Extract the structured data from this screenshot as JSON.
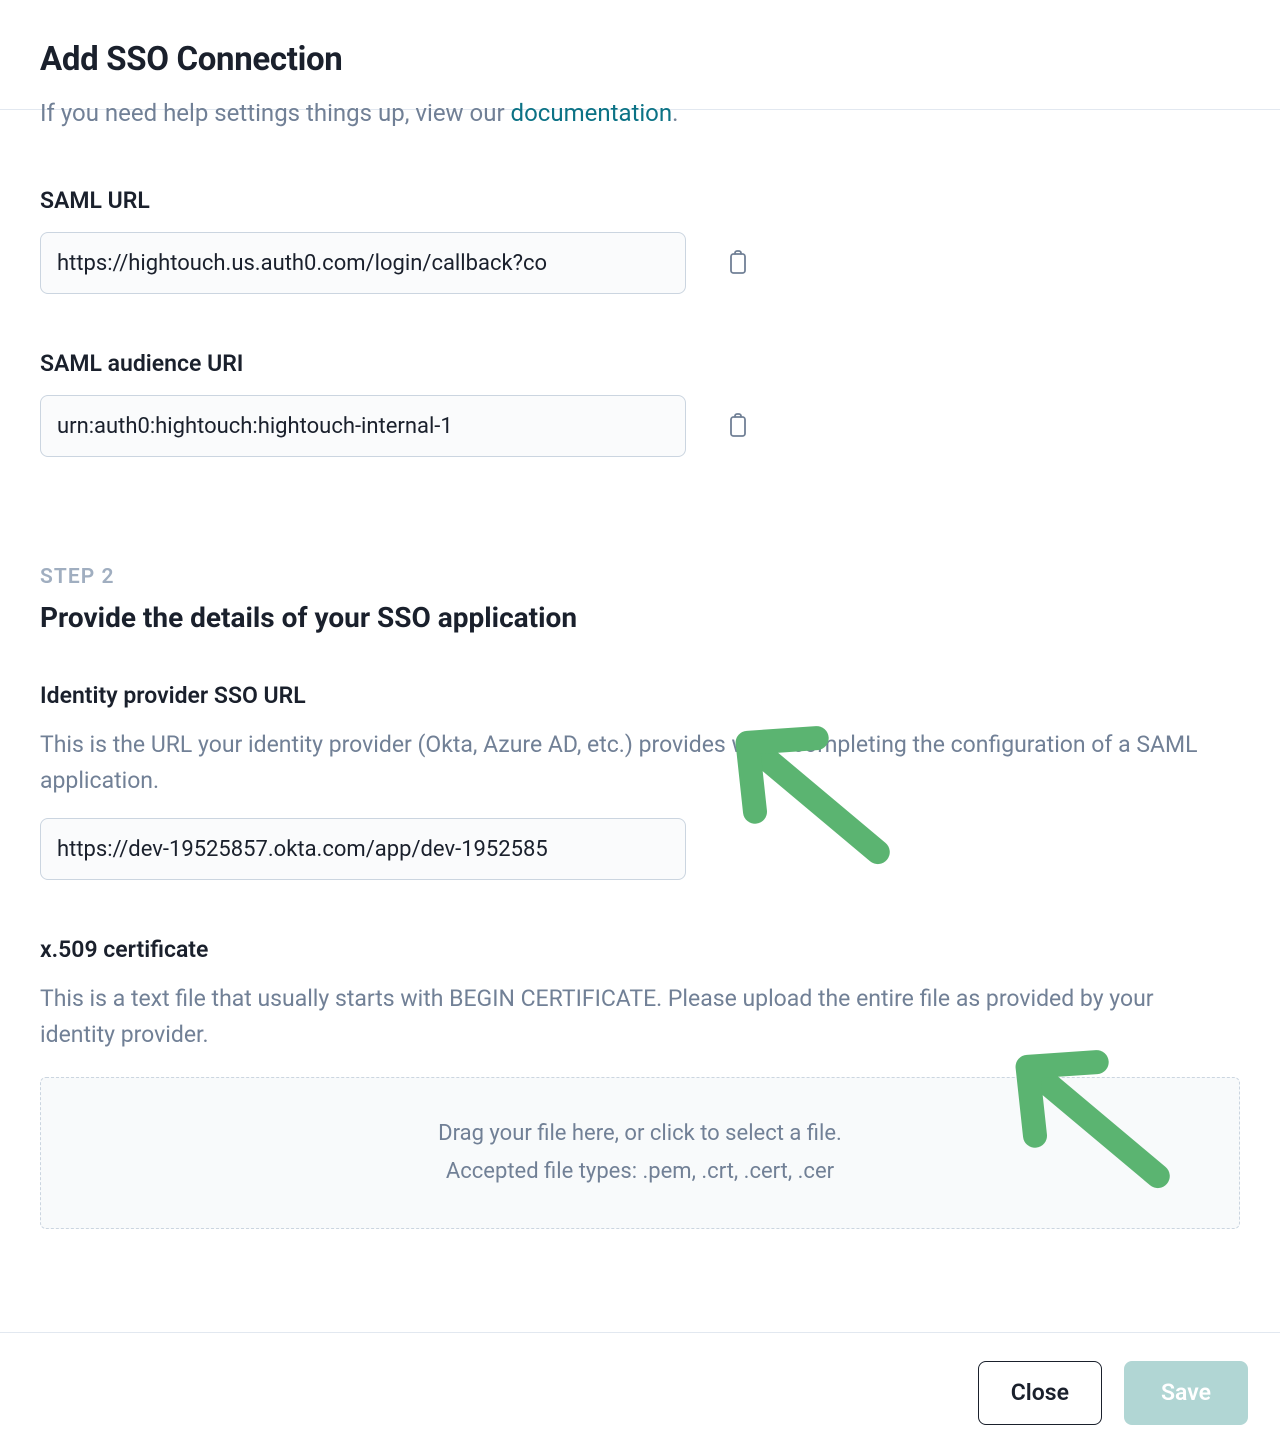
{
  "header": {
    "title": "Add SSO Connection"
  },
  "intro": {
    "prefix": "If you need help settings things up, view our ",
    "link_text": "documentation",
    "suffix": "."
  },
  "saml_url": {
    "label": "SAML URL",
    "value": "https://hightouch.us.auth0.com/login/callback?co"
  },
  "saml_audience": {
    "label": "SAML audience URI",
    "value": "urn:auth0:hightouch:hightouch-internal-1"
  },
  "step2": {
    "step_label": "STEP 2",
    "title": "Provide the details of your SSO application"
  },
  "idp_url": {
    "label": "Identity provider SSO URL",
    "description": "This is the URL your identity provider (Okta, Azure AD, etc.) provides when completing the configuration of a SAML application.",
    "value": "https://dev-19525857.okta.com/app/dev-1952585"
  },
  "cert": {
    "label": "x.509 certificate",
    "description": "This is a text file that usually starts with BEGIN CERTIFICATE. Please upload the entire file as provided by your identity provider.",
    "dropzone_line1": "Drag your file here, or click to select a file.",
    "dropzone_line2": "Accepted file types: .pem, .crt, .cert, .cer"
  },
  "footer": {
    "close_label": "Close",
    "save_label": "Save"
  },
  "colors": {
    "accent_link": "#0b7285",
    "arrow": "#5bb471",
    "save_bg": "#b1d6d4"
  }
}
